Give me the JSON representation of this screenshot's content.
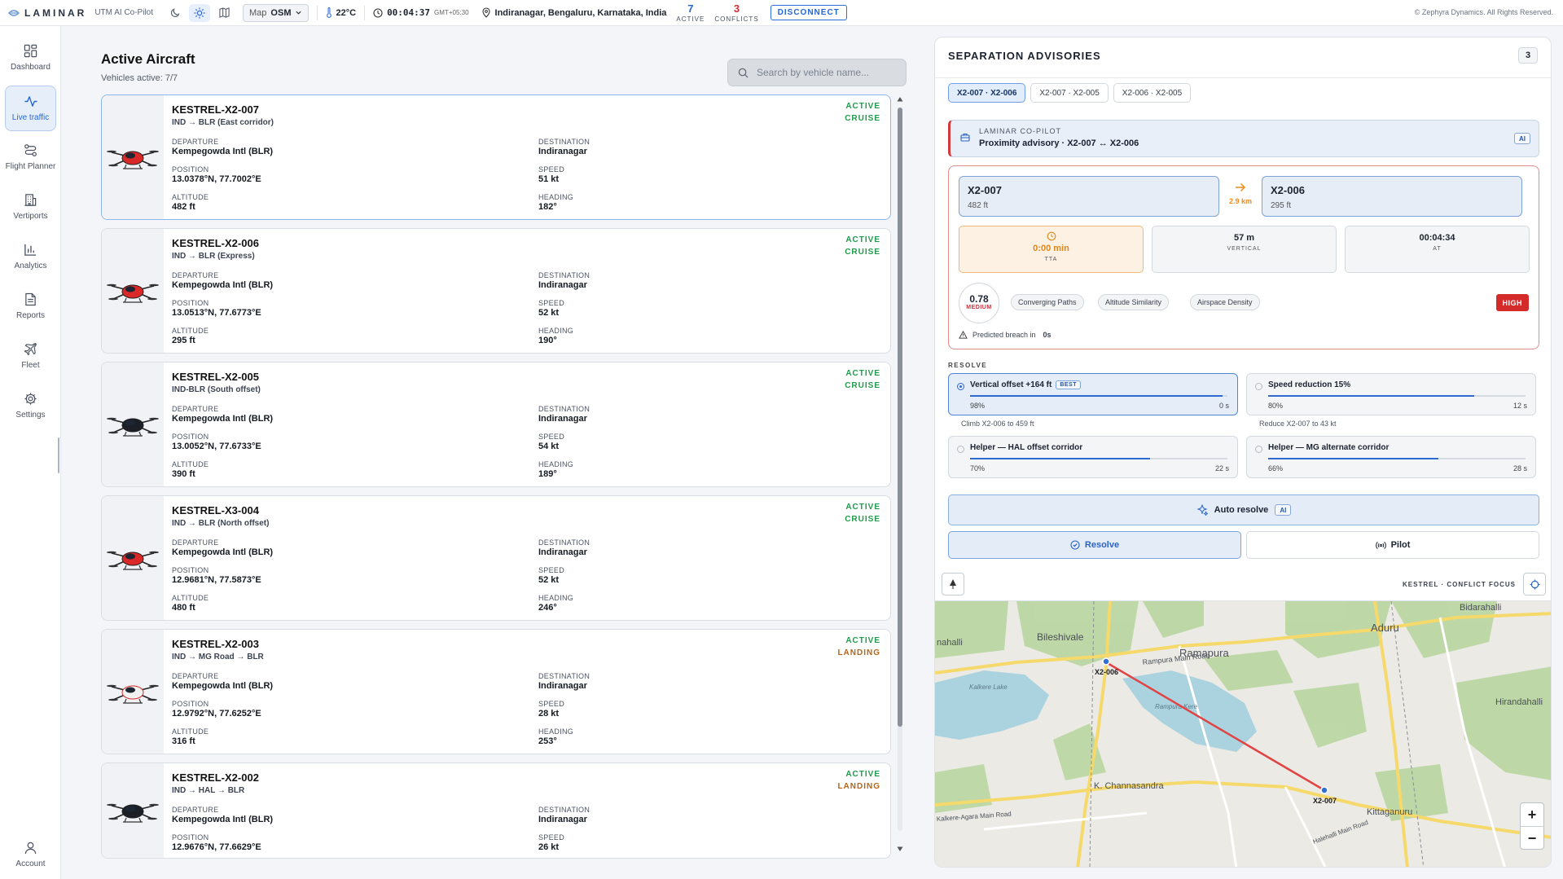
{
  "topbar": {
    "brand": "LAMINAR",
    "subtitle": "UTM AI Co-Pilot",
    "map_label": "Map",
    "map_value": "OSM",
    "temperature": "22°C",
    "time": "00:04:37",
    "timezone": "GMT+05:30",
    "location": "Indiranagar, Bengaluru, Karnataka, India",
    "active_count": "7",
    "active_label": "ACTIVE",
    "conflicts_count": "3",
    "conflicts_label": "CONFLICTS",
    "disconnect_label": "DISCONNECT",
    "copyright": "© Zephyra Dynamics. All Rights Reserved."
  },
  "sidebar": {
    "items": [
      {
        "label": "Dashboard",
        "icon": "dashboard-icon"
      },
      {
        "label": "Live traffic",
        "icon": "activity-icon"
      },
      {
        "label": "Flight Planner",
        "icon": "route-icon"
      },
      {
        "label": "Vertiports",
        "icon": "building-icon"
      },
      {
        "label": "Analytics",
        "icon": "bar-chart-icon"
      },
      {
        "label": "Reports",
        "icon": "document-icon"
      },
      {
        "label": "Fleet",
        "icon": "plane-icon"
      },
      {
        "label": "Settings",
        "icon": "gear-icon"
      }
    ],
    "account_label": "Account"
  },
  "aircraft": {
    "title": "Active Aircraft",
    "subtitle": "Vehicles active: 7/7",
    "search_placeholder": "Search by vehicle name...",
    "labels": {
      "departure": "DEPARTURE",
      "destination": "DESTINATION",
      "position": "POSITION",
      "speed": "SPEED",
      "altitude": "ALTITUDE",
      "heading": "HEADING"
    },
    "list": [
      {
        "name": "KESTREL-X2-007",
        "route": "IND → BLR (East corridor)",
        "departure": "Kempegowda Intl (BLR)",
        "destination": "Indiranagar",
        "position": "13.0378°N, 77.7002°E",
        "speed": "51 kt",
        "altitude": "482 ft",
        "heading": "182°",
        "status": "ACTIVE",
        "phase": "CRUISE",
        "drone_color": "#d82828"
      },
      {
        "name": "KESTREL-X2-006",
        "route": "IND → BLR (Express)",
        "departure": "Kempegowda Intl (BLR)",
        "destination": "Indiranagar",
        "position": "13.0513°N, 77.6773°E",
        "speed": "52 kt",
        "altitude": "295 ft",
        "heading": "190°",
        "status": "ACTIVE",
        "phase": "CRUISE",
        "drone_color": "#d82828"
      },
      {
        "name": "KESTREL-X2-005",
        "route": "IND-BLR (South offset)",
        "departure": "Kempegowda Intl (BLR)",
        "destination": "Indiranagar",
        "position": "13.0052°N, 77.6733°E",
        "speed": "54 kt",
        "altitude": "390 ft",
        "heading": "189°",
        "status": "ACTIVE",
        "phase": "CRUISE",
        "drone_color": "#1c1f26"
      },
      {
        "name": "KESTREL-X3-004",
        "route": "IND → BLR (North offset)",
        "departure": "Kempegowda Intl (BLR)",
        "destination": "Indiranagar",
        "position": "12.9681°N, 77.5873°E",
        "speed": "52 kt",
        "altitude": "480 ft",
        "heading": "246°",
        "status": "ACTIVE",
        "phase": "CRUISE",
        "drone_color": "#d82828"
      },
      {
        "name": "KESTREL-X2-003",
        "route": "IND → MG Road → BLR",
        "departure": "Kempegowda Intl (BLR)",
        "destination": "Indiranagar",
        "position": "12.9792°N, 77.6252°E",
        "speed": "28 kt",
        "altitude": "316 ft",
        "heading": "253°",
        "status": "ACTIVE",
        "phase": "LANDING",
        "drone_color": "#f2f2f2"
      },
      {
        "name": "KESTREL-X2-002",
        "route": "IND → HAL → BLR",
        "departure": "Kempegowda Intl (BLR)",
        "destination": "Indiranagar",
        "position": "12.9676°N, 77.6629°E",
        "speed": "26 kt",
        "altitude": "",
        "heading": "",
        "status": "ACTIVE",
        "phase": "LANDING",
        "drone_color": "#1c1f26"
      }
    ]
  },
  "advisories": {
    "title": "SEPARATION ADVISORIES",
    "count": "3",
    "pairs": [
      "X2-007 · X2-006",
      "X2-007 · X2-005",
      "X2-006 · X2-005"
    ],
    "copilot_label": "LAMINAR CO-PILOT",
    "copilot_text": "Proximity advisory · X2-007 ↔ X2-006",
    "ai_label": "AI",
    "vehicle_a": {
      "name": "X2-007",
      "alt": "482 ft"
    },
    "vehicle_b": {
      "name": "X2-006",
      "alt": "295 ft"
    },
    "distance": "2.9 km",
    "metrics": [
      {
        "value": "0:00 min",
        "label": "TTA"
      },
      {
        "value": "57 m",
        "label": "VERTICAL"
      },
      {
        "value": "00:04:34",
        "label": "AT"
      }
    ],
    "score": "0.78",
    "score_level": "MEDIUM",
    "factors": [
      "Converging Paths",
      "Altitude Similarity",
      "Airspace Density"
    ],
    "severity": "HIGH",
    "breach_label": "Predicted breach in",
    "breach_value": "0s",
    "resolve_title": "RESOLVE",
    "options": [
      {
        "name": "Vertical offset +164 ft",
        "tag": "BEST",
        "progress": 0.98,
        "pct": "98%",
        "time": "0 s",
        "note": "Climb X2-006 to 459 ft"
      },
      {
        "name": "Speed reduction 15%",
        "tag": "",
        "progress": 0.8,
        "pct": "80%",
        "time": "12 s",
        "note": "Reduce X2-007 to 43 kt"
      },
      {
        "name": "Helper — HAL offset corridor",
        "tag": "",
        "progress": 0.7,
        "pct": "70%",
        "time": "22 s",
        "note": ""
      },
      {
        "name": "Helper — MG alternate corridor",
        "tag": "",
        "progress": 0.66,
        "pct": "66%",
        "time": "28 s",
        "note": ""
      }
    ],
    "auto_resolve_label": "Auto resolve",
    "resolve_button": "Resolve",
    "pilot_button": "Pilot"
  },
  "map": {
    "focus_label": "KESTREL · CONFLICT FOCUS",
    "places": [
      "Bidarahalli",
      "nahalli",
      "Bileshivale",
      "Ramapura",
      "Aduru",
      "Rampura Main Road",
      "Kalkere Lake",
      "Rampura Kere",
      "Hirandahalli",
      "K. Channasandra",
      "Kalkere-Agara Main Road",
      "Kittaganuru",
      "Halehalli Main Road"
    ],
    "markers": [
      "X2-006",
      "X2-007"
    ],
    "zoom_in": "+",
    "zoom_out": "−"
  }
}
